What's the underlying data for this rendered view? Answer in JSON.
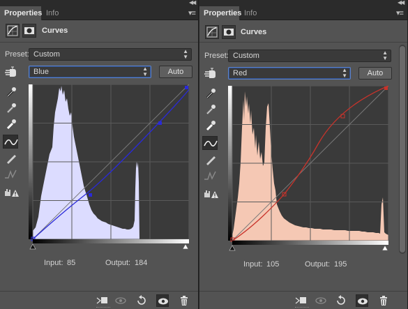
{
  "panels": [
    {
      "tabs": [
        "Properties",
        "Info"
      ],
      "title": "Curves",
      "preset_label": "Preset:",
      "preset_value": "Custom",
      "channel": "Blue",
      "auto_label": "Auto",
      "input_label": "Input:",
      "input_value": "85",
      "output_label": "Output:",
      "output_value": "184",
      "curve_color": "#2a2ad8",
      "histogram_color": "#dcdcff",
      "curve_points": [
        [
          0,
          0
        ],
        [
          85,
          184
        ],
        [
          200,
          180
        ],
        [
          255,
          255
        ]
      ],
      "histogram": [
        0,
        0,
        0,
        0,
        0,
        0,
        0,
        0,
        0,
        0,
        0,
        0,
        0,
        0,
        0,
        0,
        0,
        0,
        0,
        0,
        0,
        0,
        0,
        0,
        0,
        0,
        0,
        0,
        0,
        0,
        0,
        0,
        0,
        0,
        0,
        0,
        0,
        0,
        0,
        0,
        0,
        0,
        0,
        0,
        0,
        0,
        0,
        0,
        0,
        0,
        0,
        0,
        0,
        0,
        0,
        0,
        0,
        0,
        0,
        0,
        0,
        0,
        0,
        0
      ]
    },
    {
      "tabs": [
        "Properties",
        "Info"
      ],
      "title": "Curves",
      "preset_label": "Preset:",
      "preset_value": "Custom",
      "channel": "Red",
      "auto_label": "Auto",
      "input_label": "Input:",
      "input_value": "105",
      "output_label": "Output:",
      "output_value": "195",
      "curve_color": "#c8332b",
      "histogram_color": "#f5c8b4",
      "curve_points": [
        [
          0,
          0
        ],
        [
          105,
          195
        ],
        [
          200,
          200
        ],
        [
          255,
          255
        ]
      ]
    }
  ]
}
